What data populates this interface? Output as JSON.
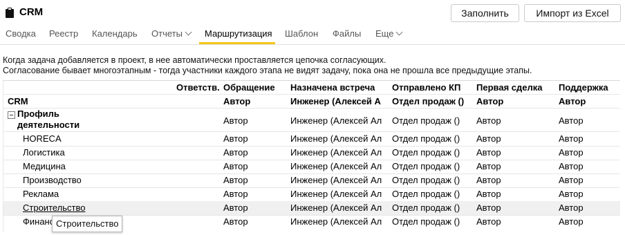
{
  "app": {
    "title": "CRM",
    "icon": "clipboard-icon"
  },
  "toolbar": {
    "fill_label": "Заполнить",
    "import_label": "Импорт из Excel"
  },
  "tabs": [
    {
      "label": "Сводка"
    },
    {
      "label": "Реестр"
    },
    {
      "label": "Календарь"
    },
    {
      "label": "Отчеты",
      "dropdown": true
    },
    {
      "label": "Маршрутизация",
      "active": true
    },
    {
      "label": "Шаблон"
    },
    {
      "label": "Файлы"
    },
    {
      "label": "Еще",
      "dropdown": true
    }
  ],
  "info": {
    "line1": "Когда задача добавляется в проект, в нее автоматически проставляется цепочка согласующих.",
    "line2": "Согласование бывает многоэтапным - тогда участники каждого этапа не видят задачу, пока она не прошла все предыдущие этапы."
  },
  "table": {
    "columns": [
      "",
      "Ответств.",
      "Обращение",
      "Назначена встреча",
      "Отправлено КП",
      "Первая сделка",
      "Поддержка"
    ],
    "crm_row": [
      "CRM",
      "",
      "Автор",
      "Инженер (Алексей А",
      "Отдел продаж ()",
      "Автор",
      "Автор"
    ],
    "group": {
      "label": "Профиль деятельности",
      "values": [
        "",
        "Автор",
        "Инженер (Алексей Ал",
        "Отдел продаж ()",
        "Автор",
        "Автор"
      ]
    },
    "rows": [
      [
        "HORECA",
        "",
        "Автор",
        "Инженер (Алексей Ал",
        "Отдел продаж ()",
        "Автор",
        "Автор"
      ],
      [
        "Логистика",
        "",
        "Автор",
        "Инженер (Алексей Ал",
        "Отдел продаж ()",
        "Автор",
        "Автор"
      ],
      [
        "Медицина",
        "",
        "Автор",
        "Инженер (Алексей Ал",
        "Отдел продаж ()",
        "Автор",
        "Автор"
      ],
      [
        "Производство",
        "",
        "Автор",
        "Инженер (Алексей Ал",
        "Отдел продаж ()",
        "Автор",
        "Автор"
      ],
      [
        "Реклама",
        "",
        "Автор",
        "Инженер (Алексей Ал",
        "Отдел продаж ()",
        "Автор",
        "Автор"
      ],
      [
        "Строительство",
        "",
        "Автор",
        "Инженер (Алексей Ал",
        "Отдел продаж ()",
        "Автор",
        "Автор"
      ],
      [
        "Финансы",
        "",
        "Автор",
        "Инженер (Алексей Ал",
        "Отдел продаж ()",
        "Автор",
        "Автор"
      ]
    ],
    "hovered_row_index": 5
  },
  "tooltip": {
    "text": "Строительство"
  },
  "colors": {
    "accent": "#f5c518",
    "hover_row": "#f0f0f0"
  }
}
